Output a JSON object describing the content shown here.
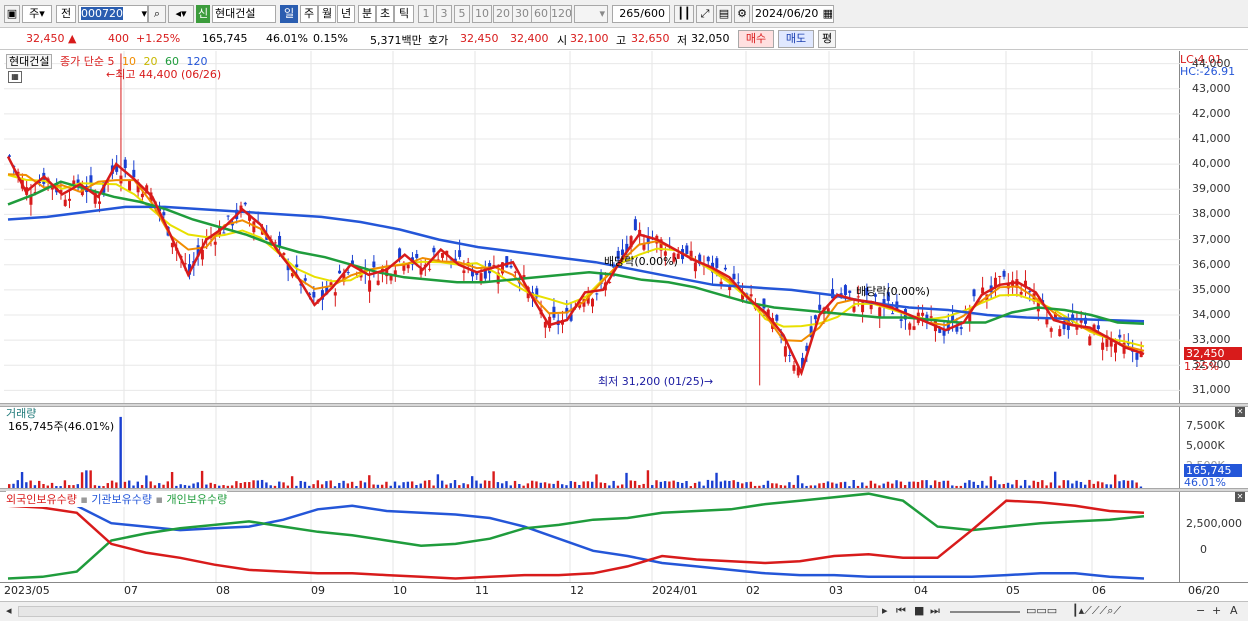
{
  "toolbar": {
    "market": "주",
    "prev": "전",
    "code": "000720",
    "name_tag": "신",
    "name": "현대건설",
    "periods": [
      "일",
      "주",
      "월",
      "년",
      "분",
      "초",
      "틱"
    ],
    "intervals": [
      "1",
      "3",
      "5",
      "10",
      "20",
      "30",
      "60",
      "120"
    ],
    "count": "265",
    "total": "/600",
    "date": "2024/06/20"
  },
  "quote": {
    "price": "32,450",
    "arrow": "▲",
    "change": "400",
    "rate": "+1.25%",
    "volume": "165,745",
    "vol_rate": "46.01%",
    "turnover": "0.15%",
    "amount": "5,371백만",
    "hoga_label": "호가",
    "ask": "32,450",
    "bid": "32,400",
    "open_label": "시",
    "open": "32,100",
    "high_label": "고",
    "high": "32,650",
    "low_label": "저",
    "low": "32,050",
    "buy": "매수",
    "sell": "매도",
    "avg": "평"
  },
  "price_pane": {
    "title": "현대건설",
    "legend_label": "종가 단순",
    "ma": [
      "5",
      "10",
      "20",
      "60",
      "120"
    ],
    "ma_colors": [
      "#d81b1b",
      "#f08c00",
      "#e8e000",
      "#1f9c3c",
      "#2456d8"
    ],
    "max_text": "최고 44,400 (06/26)",
    "min_text": "최저 31,200 (01/25)",
    "div1": "배당락(0.00%)",
    "div2": "배당락(0.00%)",
    "lc": "LC:4.01",
    "hc": "HC:-26.91",
    "last_price": "32,450",
    "last_rate": "1.25%",
    "y_ticks": [
      "44,000",
      "43,000",
      "42,000",
      "41,000",
      "40,000",
      "39,000",
      "38,000",
      "37,000",
      "36,000",
      "35,000",
      "34,000",
      "33,000",
      "32,000",
      "31,000"
    ]
  },
  "volume_pane": {
    "title": "거래량",
    "info": "165,745주(46.01%)",
    "y_ticks": [
      "7,500K",
      "5,000K",
      "2,500K"
    ],
    "last": "165,745",
    "last_rate": "46.01%"
  },
  "holdings_pane": {
    "series": [
      "외국인보유수량",
      "기관보유수량",
      "개인보유수량"
    ],
    "colors": [
      "#d81b1b",
      "#2456d8",
      "#1f9c3c"
    ],
    "y_ticks": [
      "2,500,000",
      "0"
    ]
  },
  "x_labels": [
    "2023/05",
    "07",
    "08",
    "09",
    "10",
    "11",
    "12",
    "2024/01",
    "02",
    "03",
    "04",
    "05",
    "06",
    "06/20"
  ],
  "chart_data": [
    {
      "type": "line",
      "title": "현대건설",
      "series": [
        {
          "name": "종가 단순 5",
          "values": [
            40300,
            38900,
            39500,
            38800,
            39200,
            38700,
            40000,
            39400,
            38700,
            37200,
            35600,
            37000,
            37500,
            38200,
            37600,
            36500,
            35600,
            34400,
            35100,
            36000,
            35600,
            35800,
            36400,
            35800,
            36600,
            36000,
            35700,
            35900,
            36100,
            34800,
            33600,
            33800,
            34900,
            35000,
            36200,
            37200,
            37000,
            36600,
            36200,
            35900,
            35500,
            34700,
            34100,
            33200,
            31700,
            34000,
            34800,
            34600,
            34500,
            34300,
            34000,
            33700,
            33400,
            33700,
            34800,
            35200,
            35300,
            34900,
            33800,
            33600,
            33500,
            33100,
            32700,
            32450
          ]
        },
        {
          "name": "종가 단순 60",
          "values": [
            38400,
            38800,
            39300,
            39000,
            38700,
            38500,
            38200,
            37800,
            37500,
            37200,
            36800,
            36500,
            36300,
            36000,
            35700,
            35500,
            35400,
            35300,
            35300,
            35400,
            35500,
            35600,
            35700,
            35600,
            35400,
            35300,
            35100,
            34800,
            34500,
            34300,
            34200,
            34100,
            34000,
            33900,
            33900,
            33800,
            33700,
            33700,
            34100,
            34300,
            34200,
            34000,
            33700,
            33650
          ]
        },
        {
          "name": "종가 단순 120",
          "values": [
            37800,
            37900,
            38100,
            38300,
            38300,
            38200,
            38100,
            38000,
            37900,
            37700,
            37400,
            37000,
            36700,
            36500,
            36300,
            36100,
            35800,
            35500,
            35200,
            35100,
            35000,
            34800,
            34500,
            34300,
            34200,
            34000,
            33900,
            33850,
            33800,
            33750
          ]
        }
      ],
      "min": 31200,
      "max": 44400,
      "ylim": [
        30500,
        44500
      ]
    },
    {
      "type": "bar",
      "title": "거래량",
      "last": 165745,
      "ylim": [
        0,
        9000000
      ]
    },
    {
      "type": "line",
      "series": [
        {
          "name": "외국인보유수량"
        },
        {
          "name": "기관보유수량"
        },
        {
          "name": "개인보유수량"
        }
      ],
      "ylim": [
        -1200000,
        4000000
      ]
    }
  ]
}
